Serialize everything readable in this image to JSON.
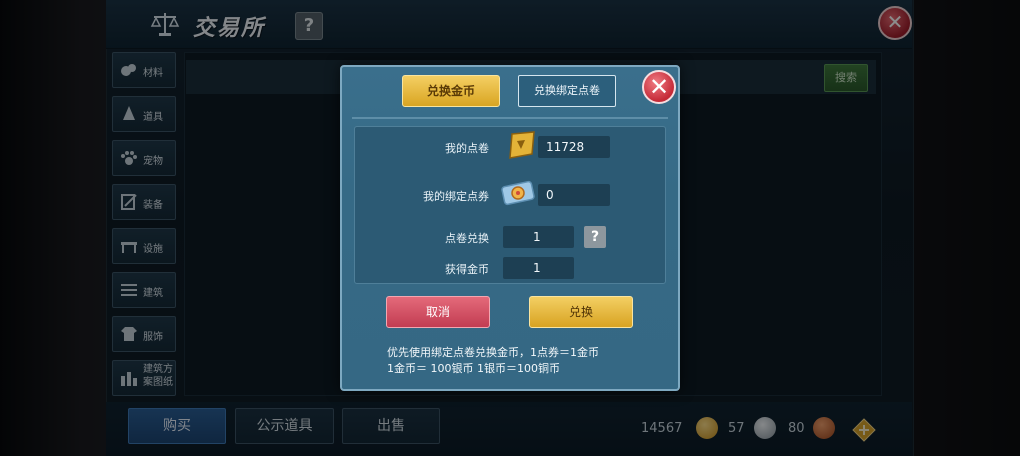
{
  "header": {
    "title": "交易所",
    "help": "?",
    "close": "✕"
  },
  "sidebar": {
    "items": [
      {
        "label": "材料",
        "icon": "material-icon"
      },
      {
        "label": "道具",
        "icon": "item-icon"
      },
      {
        "label": "宠物",
        "icon": "pet-paw-icon"
      },
      {
        "label": "装备",
        "icon": "equipment-icon"
      },
      {
        "label": "设施",
        "icon": "facility-icon"
      },
      {
        "label": "建筑",
        "icon": "building-icon"
      },
      {
        "label": "服饰",
        "icon": "clothing-icon"
      },
      {
        "label": "建筑方案图纸",
        "icon": "blueprint-icon"
      }
    ]
  },
  "search": {
    "button_label": "搜索"
  },
  "bottom_tabs": [
    {
      "label": "购买",
      "active": true
    },
    {
      "label": "公示道具",
      "active": false
    },
    {
      "label": "出售",
      "active": false
    }
  ],
  "currency": {
    "gold": "14567",
    "silver": "57",
    "copper": "80"
  },
  "modal": {
    "tab_exchange_gold": "兑换金币",
    "tab_exchange_bound": "兑换绑定点卷",
    "close": "✕",
    "rows": {
      "my_points_label": "我的点卷",
      "my_points_value": "11728",
      "my_bound_points_label": "我的绑定点券",
      "my_bound_points_value": "0",
      "points_exchange_label": "点卷兑换",
      "points_exchange_value": "1",
      "gold_received_label": "获得金币",
      "gold_received_value": "1"
    },
    "help": "?",
    "cancel_label": "取消",
    "confirm_label": "兑换",
    "note_line1": "优先使用绑定点卷兑换金币，1点券＝1金币",
    "note_line2": "1金币＝ 100银币  1银币＝100铜币"
  },
  "colors": {
    "gold_button": "#e2b23a",
    "cancel_button": "#d3505f",
    "modal_bg": "#376b87",
    "active_tab": "#24548a"
  }
}
